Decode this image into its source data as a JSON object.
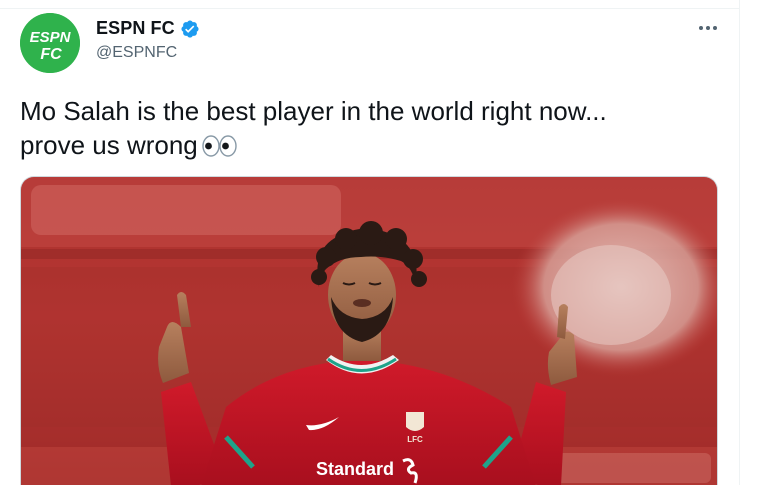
{
  "tweet": {
    "display_name": "ESPN FC",
    "handle": "@ESPNFC",
    "verified": true,
    "text_line_1": "Mo Salah is the best player in the world right now...",
    "text_line_2": "prove us wrong",
    "trailing_emoji": "eyes-emoji",
    "avatar_logo_top": "ESPN",
    "avatar_logo_bottom": "FC"
  },
  "media": {
    "kind": "photo",
    "sponsor_line": "Standard",
    "crest_text": "LFC"
  },
  "colors": {
    "avatar_bg": "#2fb24c",
    "verified_blue": "#1d9bf0",
    "text_primary": "#0f1419",
    "text_secondary": "#536471",
    "kit_red": "#c8102e"
  }
}
